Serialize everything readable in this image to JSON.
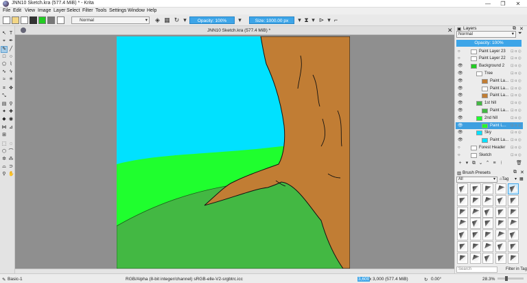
{
  "window": {
    "title": "JNN10 Sketch.kra (577.4 MiB) * - Krita",
    "minimize": "—",
    "maximize": "❐",
    "close": "✕"
  },
  "menu": [
    "File",
    "Edit",
    "View",
    "Image",
    "Layer",
    "Select",
    "Filter",
    "Tools",
    "Settings",
    "Window",
    "Help"
  ],
  "toolbar": {
    "blend_mode": "Normal",
    "opacity": "Opacity: 100%",
    "size": "Size: 1000.00 px"
  },
  "document": {
    "tab_title": "JNN10 Sketch.kra (577.4 MiB) *",
    "close": "✕"
  },
  "colors": {
    "sky": "#00e1ff",
    "hill_light": "#1fff2e",
    "hill_main": "#43b843",
    "tree": "#c17d34",
    "selection": "#3da5e8"
  },
  "status": {
    "brush": "Basic-1",
    "color_model": "RGB/Alpha (8-bit integer/channel)  sRGB-elle-V2-srgbtrc.icc",
    "dimensions_highlight": "3,600",
    "dimensions": "x 3,000 (577.4 MiB)",
    "rotation": "0.00°",
    "zoom": "28.3%"
  },
  "layers": {
    "title": "Layers",
    "blend_mode": "Normal",
    "opacity": "Opacity:  100%",
    "items": [
      {
        "name": "Paint Layer 23",
        "visible": false,
        "indent": 0,
        "thumb": "#ffffff",
        "selected": false
      },
      {
        "name": "Paint Layer 22",
        "visible": false,
        "indent": 0,
        "thumb": "#ffffff",
        "selected": false
      },
      {
        "name": "Background 2",
        "visible": true,
        "indent": 0,
        "thumb": "#22cc22",
        "selected": false
      },
      {
        "name": "Tree",
        "visible": true,
        "indent": 1,
        "thumb": "#ffffff",
        "selected": false
      },
      {
        "name": "Paint La...",
        "visible": true,
        "indent": 2,
        "thumb": "#c17d34",
        "selected": false
      },
      {
        "name": "Paint La...",
        "visible": true,
        "indent": 2,
        "thumb": "#ffffff",
        "selected": false
      },
      {
        "name": "Paint La...",
        "visible": true,
        "indent": 2,
        "thumb": "#c17d34",
        "selected": false
      },
      {
        "name": "1st hill",
        "visible": true,
        "indent": 1,
        "thumb": "#43b843",
        "selected": false
      },
      {
        "name": "Paint La...",
        "visible": true,
        "indent": 2,
        "thumb": "#43b843",
        "selected": false
      },
      {
        "name": "2nd hill",
        "visible": true,
        "indent": 1,
        "thumb": "#1fff2e",
        "selected": false
      },
      {
        "name": "Paint L...",
        "visible": true,
        "indent": 2,
        "thumb": "#1fff2e",
        "selected": true
      },
      {
        "name": "Sky",
        "visible": true,
        "indent": 1,
        "thumb": "#00e1ff",
        "selected": false
      },
      {
        "name": "Paint La...",
        "visible": true,
        "indent": 2,
        "thumb": "#00e1ff",
        "selected": false
      },
      {
        "name": "Forest Header",
        "visible": false,
        "indent": 0,
        "thumb": "#ffffff",
        "selected": false
      },
      {
        "name": "Sketch",
        "visible": false,
        "indent": 0,
        "thumb": "#ffffff",
        "selected": false
      }
    ]
  },
  "brushes": {
    "title": "Brush Presets",
    "filter": "All",
    "tag": "Tag",
    "search_placeholder": "Search",
    "filter_in_tag": "Filter in Tag"
  }
}
